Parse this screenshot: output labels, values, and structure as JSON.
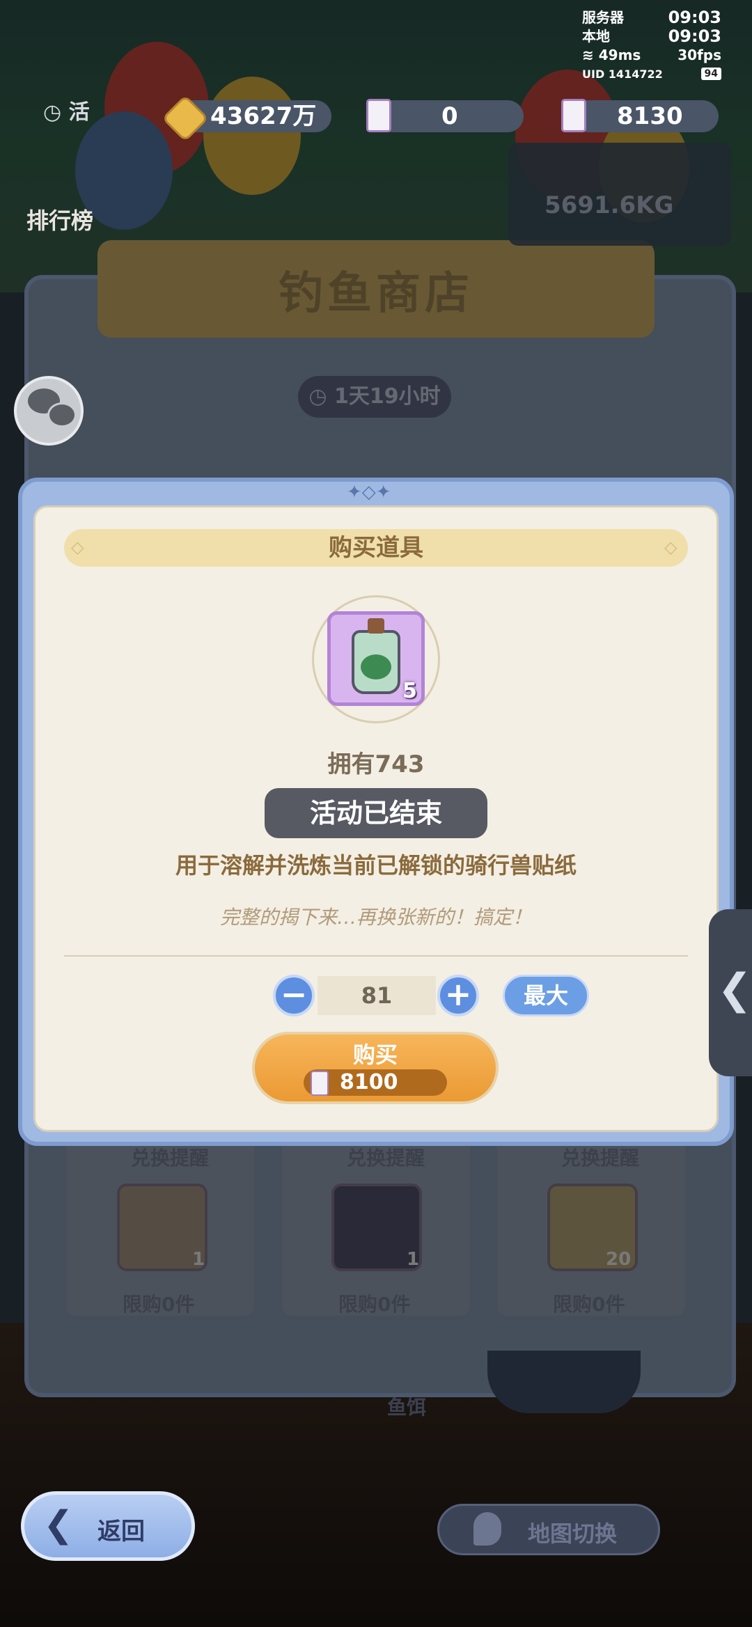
{
  "status": {
    "server_label": "服务器",
    "server_time": "09:03",
    "local_label": "本地",
    "local_time": "09:03",
    "ping": "49ms",
    "fps": "30fps",
    "uid": "UID 1414722",
    "battery": "94"
  },
  "currencies": {
    "gold": "43627万",
    "ticket_a": "0",
    "ticket_b": "8130"
  },
  "background": {
    "rank_label": "排行榜",
    "shop_title": "钓鱼商店",
    "timer": "1天19小时",
    "weight": "5691.6KG",
    "cards": [
      {
        "remind": "兑换提醒",
        "count": "1",
        "limit": "限购0件"
      },
      {
        "remind": "兑换提醒",
        "count": "1",
        "limit": "限购0件"
      },
      {
        "remind": "兑换提醒",
        "count": "20",
        "limit": "限购0件"
      }
    ],
    "bait_label": "鱼饵"
  },
  "dialog": {
    "title": "购买道具",
    "item_count": "5",
    "owned": "拥有743",
    "status": "活动已结束",
    "description": "用于溶解并洗炼当前已解锁的骑行兽贴纸",
    "flavor": "完整的揭下来…再换张新的！搞定！",
    "quantity": "81",
    "max_label": "最大",
    "buy_label": "购买",
    "price": "8100"
  },
  "bottom": {
    "back_label": "返回",
    "map_label": "地图切换"
  },
  "colors": {
    "accent_blue": "#5d8ee0",
    "buy_orange": "#eb9a34",
    "dialog_bg": "#f4efe4"
  }
}
